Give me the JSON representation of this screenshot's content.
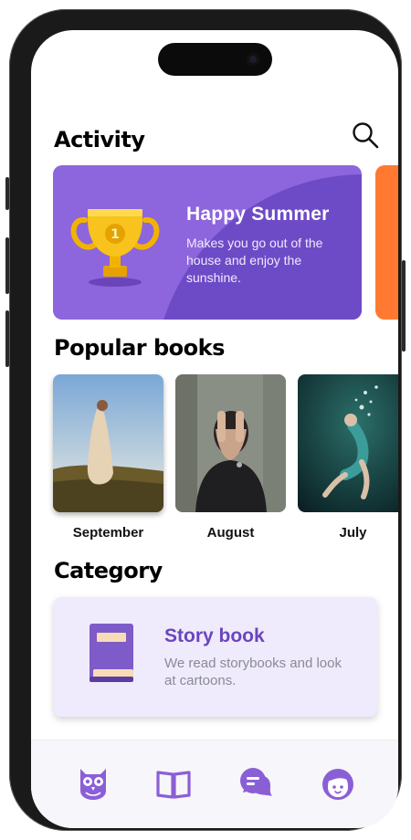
{
  "header": {
    "title": "Activity"
  },
  "activity": {
    "title": "Happy Summer",
    "description": "Makes you go out of the house and enjoy the sunshine.",
    "colors": {
      "card": "#8d65dc",
      "next_card": "#ff7a30"
    }
  },
  "popular": {
    "title": "Popular books",
    "books": [
      {
        "label": "September"
      },
      {
        "label": "August"
      },
      {
        "label": "July"
      }
    ]
  },
  "category": {
    "title": "Category",
    "card": {
      "title": "Story book",
      "description": "We read storybooks and look at cartoons."
    }
  },
  "tabbar": {
    "items": [
      {
        "icon": "owl-icon"
      },
      {
        "icon": "book-open-icon"
      },
      {
        "icon": "chat-icon"
      },
      {
        "icon": "profile-icon"
      }
    ],
    "accent": "#8a5fd6"
  }
}
